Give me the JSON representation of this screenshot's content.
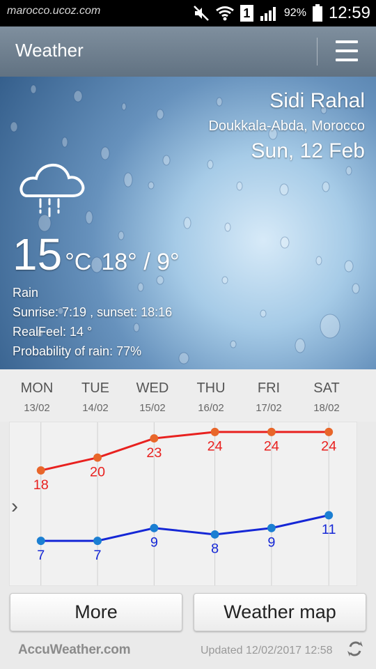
{
  "status": {
    "site": "marocco.ucoz.com",
    "sim": "1",
    "battery": "92%",
    "time": "12:59"
  },
  "app": {
    "title": "Weather"
  },
  "location": {
    "city": "Sidi Rahal",
    "region": "Doukkala-Abda, Morocco",
    "date": "Sun, 12 Feb"
  },
  "current": {
    "temp": "15",
    "unit": "°C",
    "hi_lo": "18° / 9°",
    "condition": "Rain",
    "sun": "Sunrise: 7:19 , sunset: 18:16",
    "realfeel": "RealFeel: 14 °",
    "rain_probability": "Probability of rain: 77%",
    "icon": "cloud-rain-icon"
  },
  "forecast": [
    {
      "day": "MON",
      "date": "13/02"
    },
    {
      "day": "TUE",
      "date": "14/02"
    },
    {
      "day": "WED",
      "date": "15/02"
    },
    {
      "day": "THU",
      "date": "16/02"
    },
    {
      "day": "FRI",
      "date": "17/02"
    },
    {
      "day": "SAT",
      "date": "18/02"
    }
  ],
  "chart_data": {
    "type": "line",
    "categories": [
      "MON",
      "TUE",
      "WED",
      "THU",
      "FRI",
      "SAT"
    ],
    "series": [
      {
        "values": [
          18,
          20,
          23,
          24,
          24,
          24
        ],
        "color": "#e8211f",
        "marker_color": "#e8662a"
      },
      {
        "values": [
          7,
          7,
          9,
          8,
          9,
          11
        ],
        "color": "#1527d6",
        "marker_color": "#1b7fd2"
      }
    ],
    "grid": "vertical"
  },
  "buttons": {
    "more": "More",
    "weather_map": "Weather map"
  },
  "footer": {
    "brand": "AccuWeather.com",
    "updated": "Updated 12/02/2017 12:58"
  },
  "colors": {
    "status_bar": "#000000",
    "app_bar": "#6f8090",
    "high_line": "#e8211f",
    "low_line": "#1527d6"
  }
}
